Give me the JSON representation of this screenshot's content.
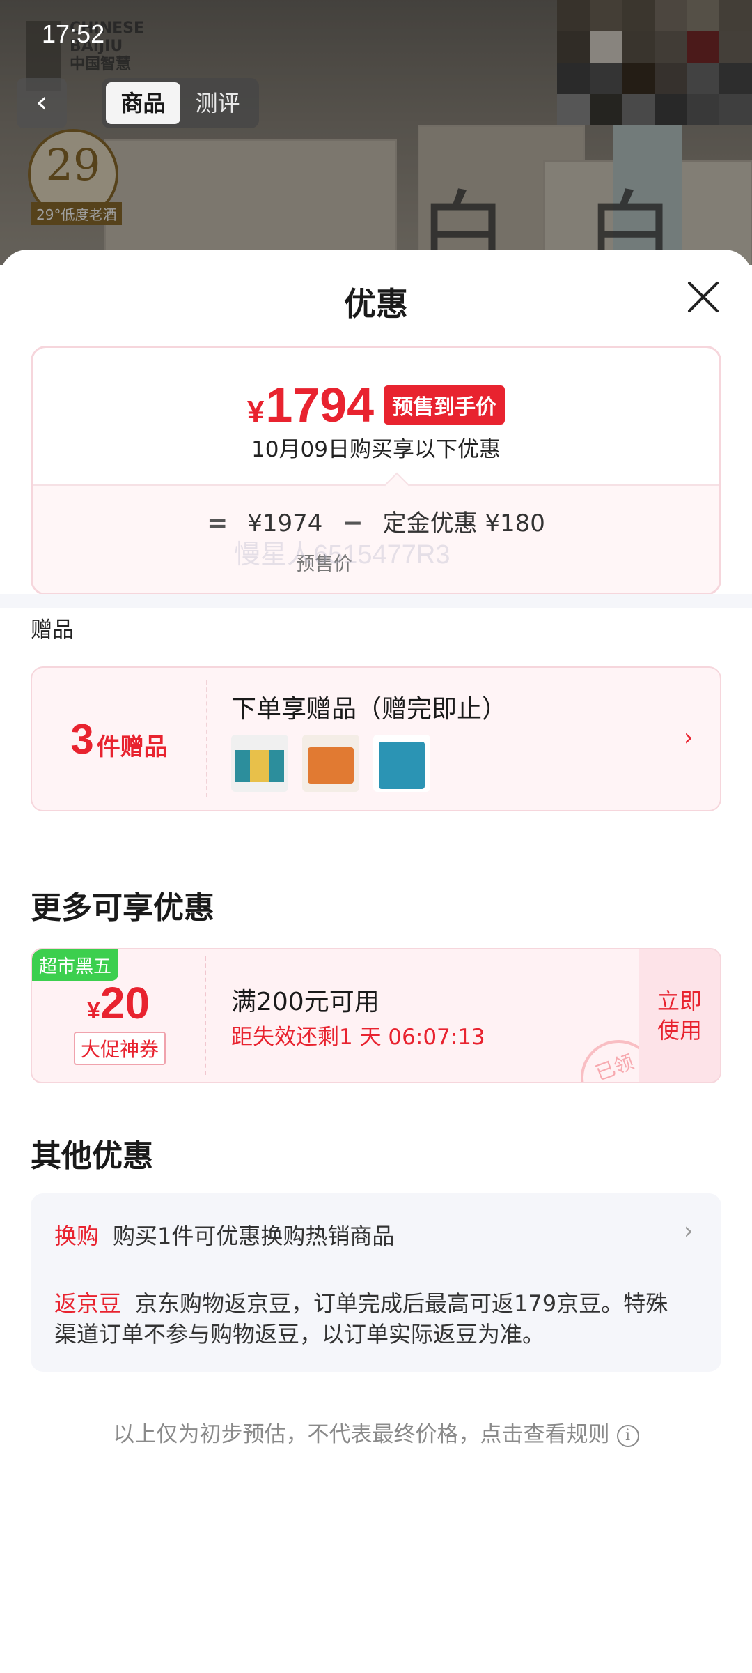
{
  "status_bar": {
    "time": "17:52"
  },
  "header": {
    "tabs": [
      {
        "label": "商品",
        "active": true
      },
      {
        "label": "测评",
        "active": false
      }
    ],
    "background": {
      "brand_lines": [
        "CHINESE",
        "BAIJIU",
        "中国智慧"
      ],
      "badge_number": "29",
      "badge_label": "29°低度老酒"
    }
  },
  "sheet": {
    "title": "优惠",
    "price_card": {
      "currency": "¥",
      "final_price": "1794",
      "tag": "预售到手价",
      "subtitle": "10月09日购买享以下优惠",
      "formula": {
        "equals": "=",
        "presale_price": "¥1974",
        "minus": "−",
        "deposit_discount": "定金优惠 ¥180",
        "presale_label": "预售价"
      }
    },
    "gifts": {
      "section_label": "赠品",
      "count_number": "3",
      "count_text": "件赠品",
      "title": "下单享赠品（赠完即止）",
      "thumbs": [
        "gift-set-green",
        "gift-box-orange",
        "gift-bag-blue"
      ],
      "watermark": "慢星人6515477R3"
    },
    "more_offers": {
      "title": "更多可享优惠",
      "coupon": {
        "badge": "超市黑五",
        "currency": "¥",
        "amount": "20",
        "type": "大促神券",
        "condition": "满200元可用",
        "timer": "距失效还剩1 天 06:07:13",
        "action": "立即使用",
        "stamp": "已领"
      }
    },
    "other_offers": {
      "title": "其他优惠",
      "rows": [
        {
          "tag": "换购",
          "text": "购买1件可优惠换购热销商品"
        },
        {
          "tag": "返京豆",
          "text": "京东购物返京豆，订单完成后最高可返179京豆。特殊渠道订单不参与购物返豆，以订单实际返豆为准。"
        }
      ]
    },
    "footer_note": "以上仅为初步预估，不代表最终价格，点击查看规则"
  },
  "colors": {
    "accent": "#e8232f",
    "coupon_badge": "#3ccf4e",
    "soft_pink": "#fff4f6"
  }
}
